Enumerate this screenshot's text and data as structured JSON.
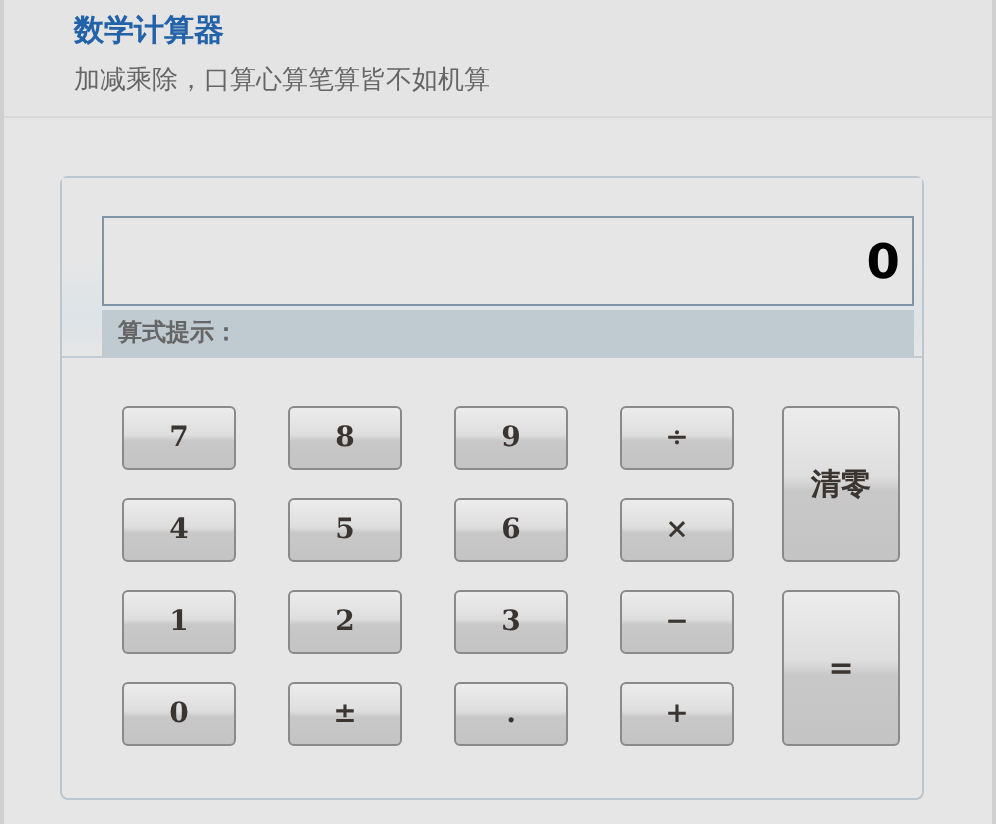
{
  "header": {
    "title": "数学计算器",
    "subtitle": "加减乘除，口算心算笔算皆不如机算"
  },
  "display": {
    "value": "0",
    "hint_label": "算式提示："
  },
  "keys": [
    {
      "label": "7",
      "kind": "key"
    },
    {
      "label": "8",
      "kind": "key"
    },
    {
      "label": "9",
      "kind": "key"
    },
    {
      "label": "÷",
      "kind": "key"
    },
    {
      "label": "清零",
      "kind": "tall"
    },
    {
      "label": "4",
      "kind": "key"
    },
    {
      "label": "5",
      "kind": "key"
    },
    {
      "label": "6",
      "kind": "key"
    },
    {
      "label": "×",
      "kind": "key"
    },
    {
      "label": "1",
      "kind": "key"
    },
    {
      "label": "2",
      "kind": "key"
    },
    {
      "label": "3",
      "kind": "key"
    },
    {
      "label": "−",
      "kind": "key"
    },
    {
      "label": "=",
      "kind": "tall"
    },
    {
      "label": "0",
      "kind": "key"
    },
    {
      "label": "±",
      "kind": "key"
    },
    {
      "label": ".",
      "kind": "key"
    },
    {
      "label": "+",
      "kind": "key"
    }
  ]
}
